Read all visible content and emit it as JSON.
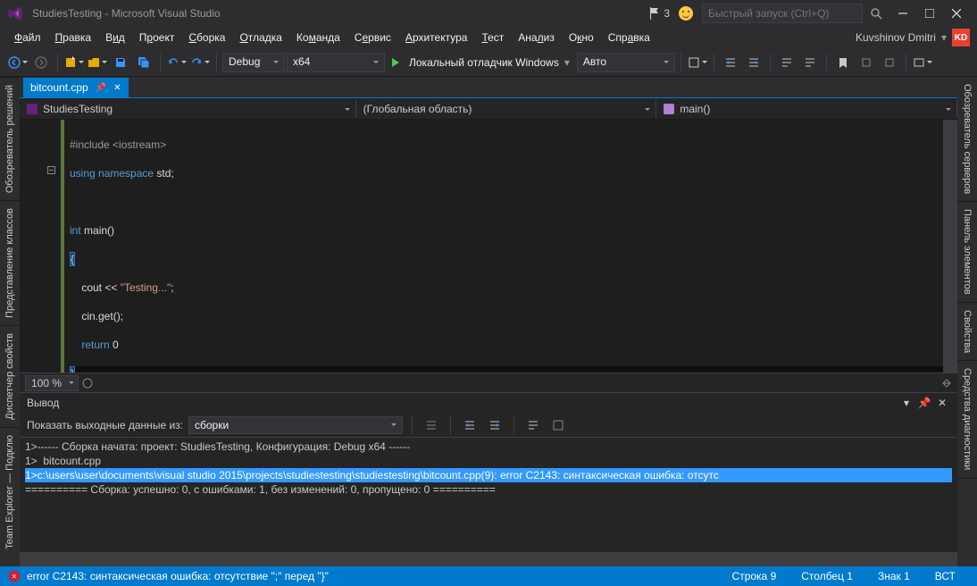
{
  "title": "StudiesTesting - Microsoft Visual Studio",
  "flag_count": "3",
  "quick_launch_placeholder": "Быстрый запуск (Ctrl+Q)",
  "menu": [
    "Файл",
    "Правка",
    "Вид",
    "Проект",
    "Сборка",
    "Отладка",
    "Команда",
    "Сервис",
    "Архитектура",
    "Тест",
    "Анализ",
    "Окно",
    "Справка"
  ],
  "user": {
    "name": "Kuvshinov Dmitri",
    "initials": "KD"
  },
  "toolbar": {
    "config": "Debug",
    "platform": "x64",
    "run_label": "Локальный отладчик Windows",
    "auto": "Авто"
  },
  "tab": {
    "name": "bitcount.cpp"
  },
  "nav": {
    "project": "StudiesTesting",
    "scope": "(Глобальная область)",
    "func": "main()"
  },
  "code": {
    "l1a": "#include ",
    "l1b": "<iostream>",
    "l2a": "using ",
    "l2b": "namespace",
    "l2c": " std;",
    "l3a": "int",
    "l3b": " main()",
    "l4": "{",
    "l5a": "    cout << ",
    "l5b": "\"Testing...\"",
    "l5c": ";",
    "l6": "    cin.get();",
    "l7a": "    ",
    "l7b": "return",
    "l7c": " 0",
    "l8": "}"
  },
  "zoom": "100 %",
  "output": {
    "title": "Вывод",
    "from_label": "Показать выходные данные из:",
    "from_value": "сборки",
    "lines": [
      "1>------ Сборка начата: проект: StudiesTesting, Конфигурация: Debug x64 ------",
      "1>  bitcount.cpp",
      "1>c:\\users\\user\\documents\\visual studio 2015\\projects\\studiestesting\\studiestesting\\bitcount.cpp(9): error C2143: синтаксическая ошибка: отсутс",
      "========== Сборка: успешно: 0, с ошибками: 1, без изменений: 0, пропущено: 0 =========="
    ]
  },
  "status": {
    "error": "error C2143: синтаксическая ошибка: отсутствие \";\" перед \"}\"",
    "line": "Строка 9",
    "col": "Столбец 1",
    "ch": "Знак 1",
    "ins": "ВСТ"
  },
  "side": {
    "left1": "Обозреватель решений",
    "left2": "Представление классов",
    "left3": "Диспетчер свойств",
    "left4": "Team Explorer — Подклю",
    "right1": "Обозреватель серверов",
    "right2": "Панель элементов",
    "right3": "Свойства",
    "right4": "Средства диагностики"
  }
}
